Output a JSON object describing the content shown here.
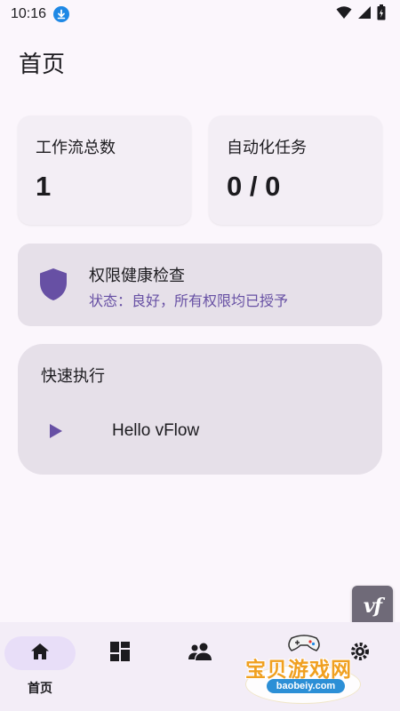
{
  "status_bar": {
    "time": "10:16",
    "icons": [
      "download-notification-icon",
      "wifi-icon",
      "cell-signal-icon",
      "battery-icon"
    ]
  },
  "page": {
    "title": "首页"
  },
  "stats": [
    {
      "label": "工作流总数",
      "value": "1"
    },
    {
      "label": "自动化任务",
      "value": "0 / 0"
    }
  ],
  "permission_card": {
    "icon": "shield-icon",
    "title": "权限健康检查",
    "status": "状态：良好，所有权限均已授予"
  },
  "quick_run": {
    "title": "快速执行",
    "items": [
      {
        "icon": "play-icon",
        "label": "Hello vFlow"
      }
    ]
  },
  "floating_badge": {
    "text": "vf"
  },
  "bottom_nav": {
    "items": [
      {
        "icon": "home-icon",
        "label": "首页",
        "active": true
      },
      {
        "icon": "dashboard-icon",
        "label": ""
      },
      {
        "icon": "people-icon",
        "label": ""
      },
      {
        "icon": "settings-icon",
        "label": ""
      }
    ]
  },
  "watermark": {
    "text": "宝贝游戏网",
    "url": "baobeiy.com"
  },
  "colors": {
    "background": "#fbf6fc",
    "accent": "#6750a4",
    "card": "#f3eef5",
    "card_tonal": "#e6e0e9",
    "nav_active": "#e8def8"
  }
}
